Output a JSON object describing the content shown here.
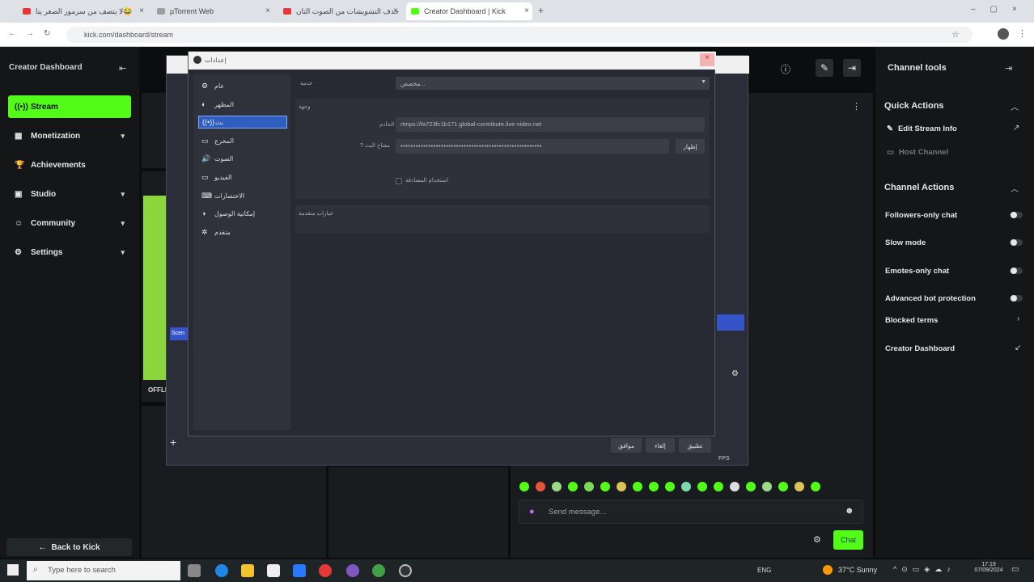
{
  "browser": {
    "tabs": [
      {
        "title": "لا يتصف من سرمور الصغر ينا😂",
        "active": false,
        "color": "#e53935"
      },
      {
        "title": "µTorrent Web",
        "active": false,
        "color": "#9e9e9e"
      },
      {
        "title": "حذف التشويشات من الصوت التان !",
        "active": false,
        "color": "#e53935"
      },
      {
        "title": "Creator Dashboard | Kick",
        "active": true,
        "color": "#53fc18"
      }
    ],
    "url": "kick.com/dashboard/stream"
  },
  "sidebar": {
    "title": "Creator Dashboard",
    "items": [
      {
        "label": "Stream",
        "icon": "stream-icon",
        "glyph": "((•))",
        "active": true,
        "chevron": false
      },
      {
        "label": "Monetization",
        "icon": "monetization-icon",
        "glyph": "▦",
        "active": false,
        "chevron": true
      },
      {
        "label": "Achievements",
        "icon": "trophy-icon",
        "glyph": "🏆",
        "active": false,
        "chevron": false
      },
      {
        "label": "Studio",
        "icon": "studio-icon",
        "glyph": "▣",
        "active": false,
        "chevron": true
      },
      {
        "label": "Community",
        "icon": "community-icon",
        "glyph": "☺",
        "active": false,
        "chevron": true
      },
      {
        "label": "Settings",
        "icon": "gear-icon",
        "glyph": "⚙",
        "active": false,
        "chevron": true
      }
    ],
    "back_label": "Back to Kick"
  },
  "stream_panel": {
    "offline_label": "OFFLI",
    "scene_label": "Scen",
    "fps_label": "FPS"
  },
  "obs_settings": {
    "title": "إعدادات",
    "nav": [
      {
        "label": "عام",
        "glyph": "⚙",
        "active": false
      },
      {
        "label": "المظهر",
        "glyph": "◐",
        "active": false
      },
      {
        "label": "بث",
        "glyph": "((•))",
        "active": true
      },
      {
        "label": "المخرج",
        "glyph": "▭",
        "active": false
      },
      {
        "label": "الصوت",
        "glyph": "🔊",
        "active": false
      },
      {
        "label": "الفيديو",
        "glyph": "▭",
        "active": false
      },
      {
        "label": "الاختصارات",
        "glyph": "⌨",
        "active": false
      },
      {
        "label": "إمكانية الوصول",
        "glyph": "◑",
        "active": false
      },
      {
        "label": "متقدم",
        "glyph": "✲",
        "active": false
      }
    ],
    "service_label": "خدمة",
    "service_value": "مخصص...",
    "destination_label": "وجهة",
    "server_label": "الخادم",
    "server_value": "rtmps://fa723fc1b171.global-contribute.live-video.net",
    "key_label": "مفتاح البث",
    "key_value": "••••••••••••••••••••••••••••••••••••••••••••••••••••••••",
    "show_button": "إظهار",
    "auth_label": "استخدام المصادقة",
    "advanced_label": "خيارات متقدمة",
    "ok_button": "موافق",
    "cancel_button": "إلغاء",
    "apply_button": "تطبيق"
  },
  "tools": {
    "title": "Channel tools",
    "quick_actions_title": "Quick Actions",
    "edit_stream_info": "Edit Stream Info",
    "host_channel": "Host Channel",
    "channel_actions_title": "Channel Actions",
    "toggles": [
      {
        "label": "Followers-only chat",
        "on": false
      },
      {
        "label": "Slow mode",
        "on": false
      },
      {
        "label": "Emotes-only chat",
        "on": false
      },
      {
        "label": "Advanced bot protection",
        "on": false
      }
    ],
    "blocked_terms": "Blocked terms",
    "creator_dashboard": "Creator Dashboard"
  },
  "chat": {
    "placeholder": "Send message...",
    "send_label": "Chat"
  },
  "taskbar": {
    "search_placeholder": "Type here to search",
    "lang": "ENG",
    "weather": "37°C  Sunny",
    "time": "17:19",
    "date": "07/09/2024"
  },
  "colors": {
    "kick_green": "#53fc18",
    "obs_select": "#2e5ebf"
  }
}
